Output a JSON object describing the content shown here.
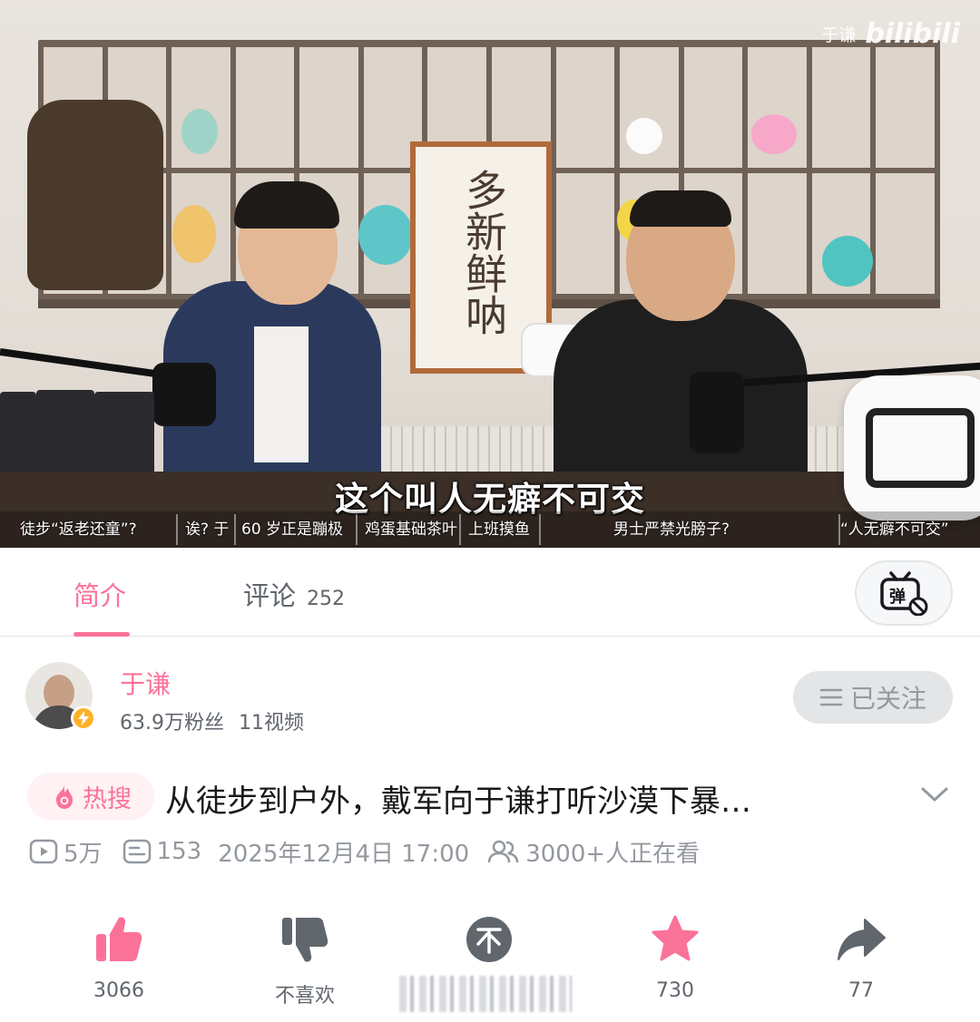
{
  "video": {
    "watermark": {
      "name": "于谦",
      "logo": "bilibili"
    },
    "sign_text": "多新鲜呐",
    "subtitle": "这个叫人无癖不可交",
    "chapters": [
      "徒步“返老还童”?",
      "诶? 于",
      "60 岁正是蹦极",
      "鸡蛋基础茶叶",
      "上班摸鱼",
      "男士严禁光膀子?",
      "“人无癖不可交”"
    ]
  },
  "tabs": {
    "intro": "简介",
    "comments": "评论",
    "comments_count": "252",
    "danmaku_icon": "danmaku-off-icon",
    "danmaku_label": "弹"
  },
  "uploader": {
    "name": "于谦",
    "fans": "63.9万粉丝",
    "videos": "11视频",
    "follow_label": "已关注",
    "follow_icon": "menu-icon"
  },
  "title": {
    "badge": "热搜",
    "badge_icon": "flame-icon",
    "text": "从徒步到户外，戴军向于谦打听沙漠下暴…"
  },
  "meta": {
    "views": "5万",
    "danmaku": "153",
    "datetime": "2025年12月4日 17:00",
    "watching": "3000+人正在看"
  },
  "actions": {
    "like": "3066",
    "dislike": "不喜欢",
    "coin": "",
    "favorite": "730",
    "share": "77"
  },
  "colors": {
    "brand_pink": "#fb7299",
    "text_secondary": "#61666d",
    "text_muted": "#9499a0"
  }
}
